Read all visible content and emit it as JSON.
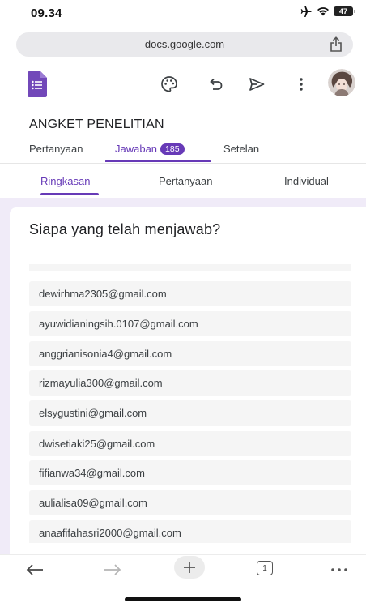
{
  "status_bar": {
    "time": "09.34",
    "battery": "47",
    "icons": [
      "airplane-icon",
      "wifi-icon",
      "battery-icon"
    ]
  },
  "browser": {
    "url": "docs.google.com",
    "tab_count": "1"
  },
  "toolbar": {
    "icons": [
      "palette-icon",
      "undo-icon",
      "send-icon",
      "more-vert-icon"
    ]
  },
  "form": {
    "title": "ANGKET PENELITIAN"
  },
  "main_tabs": [
    {
      "label": "Pertanyaan",
      "active": false
    },
    {
      "label": "Jawaban",
      "active": true,
      "badge": "185"
    },
    {
      "label": "Setelan",
      "active": false
    }
  ],
  "sub_tabs": [
    {
      "label": "Ringkasan",
      "active": true
    },
    {
      "label": "Pertanyaan",
      "active": false
    },
    {
      "label": "Individual",
      "active": false
    }
  ],
  "responses": {
    "heading": "Siapa yang telah menjawab?",
    "emails": [
      "dewirhma2305@gmail.com",
      "ayuwidianingsih.0107@gmail.com",
      "anggrianisonia4@gmail.com",
      "rizmayulia300@gmail.com",
      "elsygustini@gmail.com",
      "dwisetiaki25@gmail.com",
      "fifianwa34@gmail.com",
      "aulialisa09@gmail.com",
      "anaafifahasri2000@gmail.com"
    ]
  },
  "colors": {
    "accent": "#673ab7",
    "page_background": "#f0ebf8",
    "list_item_background": "#f5f5f5"
  }
}
